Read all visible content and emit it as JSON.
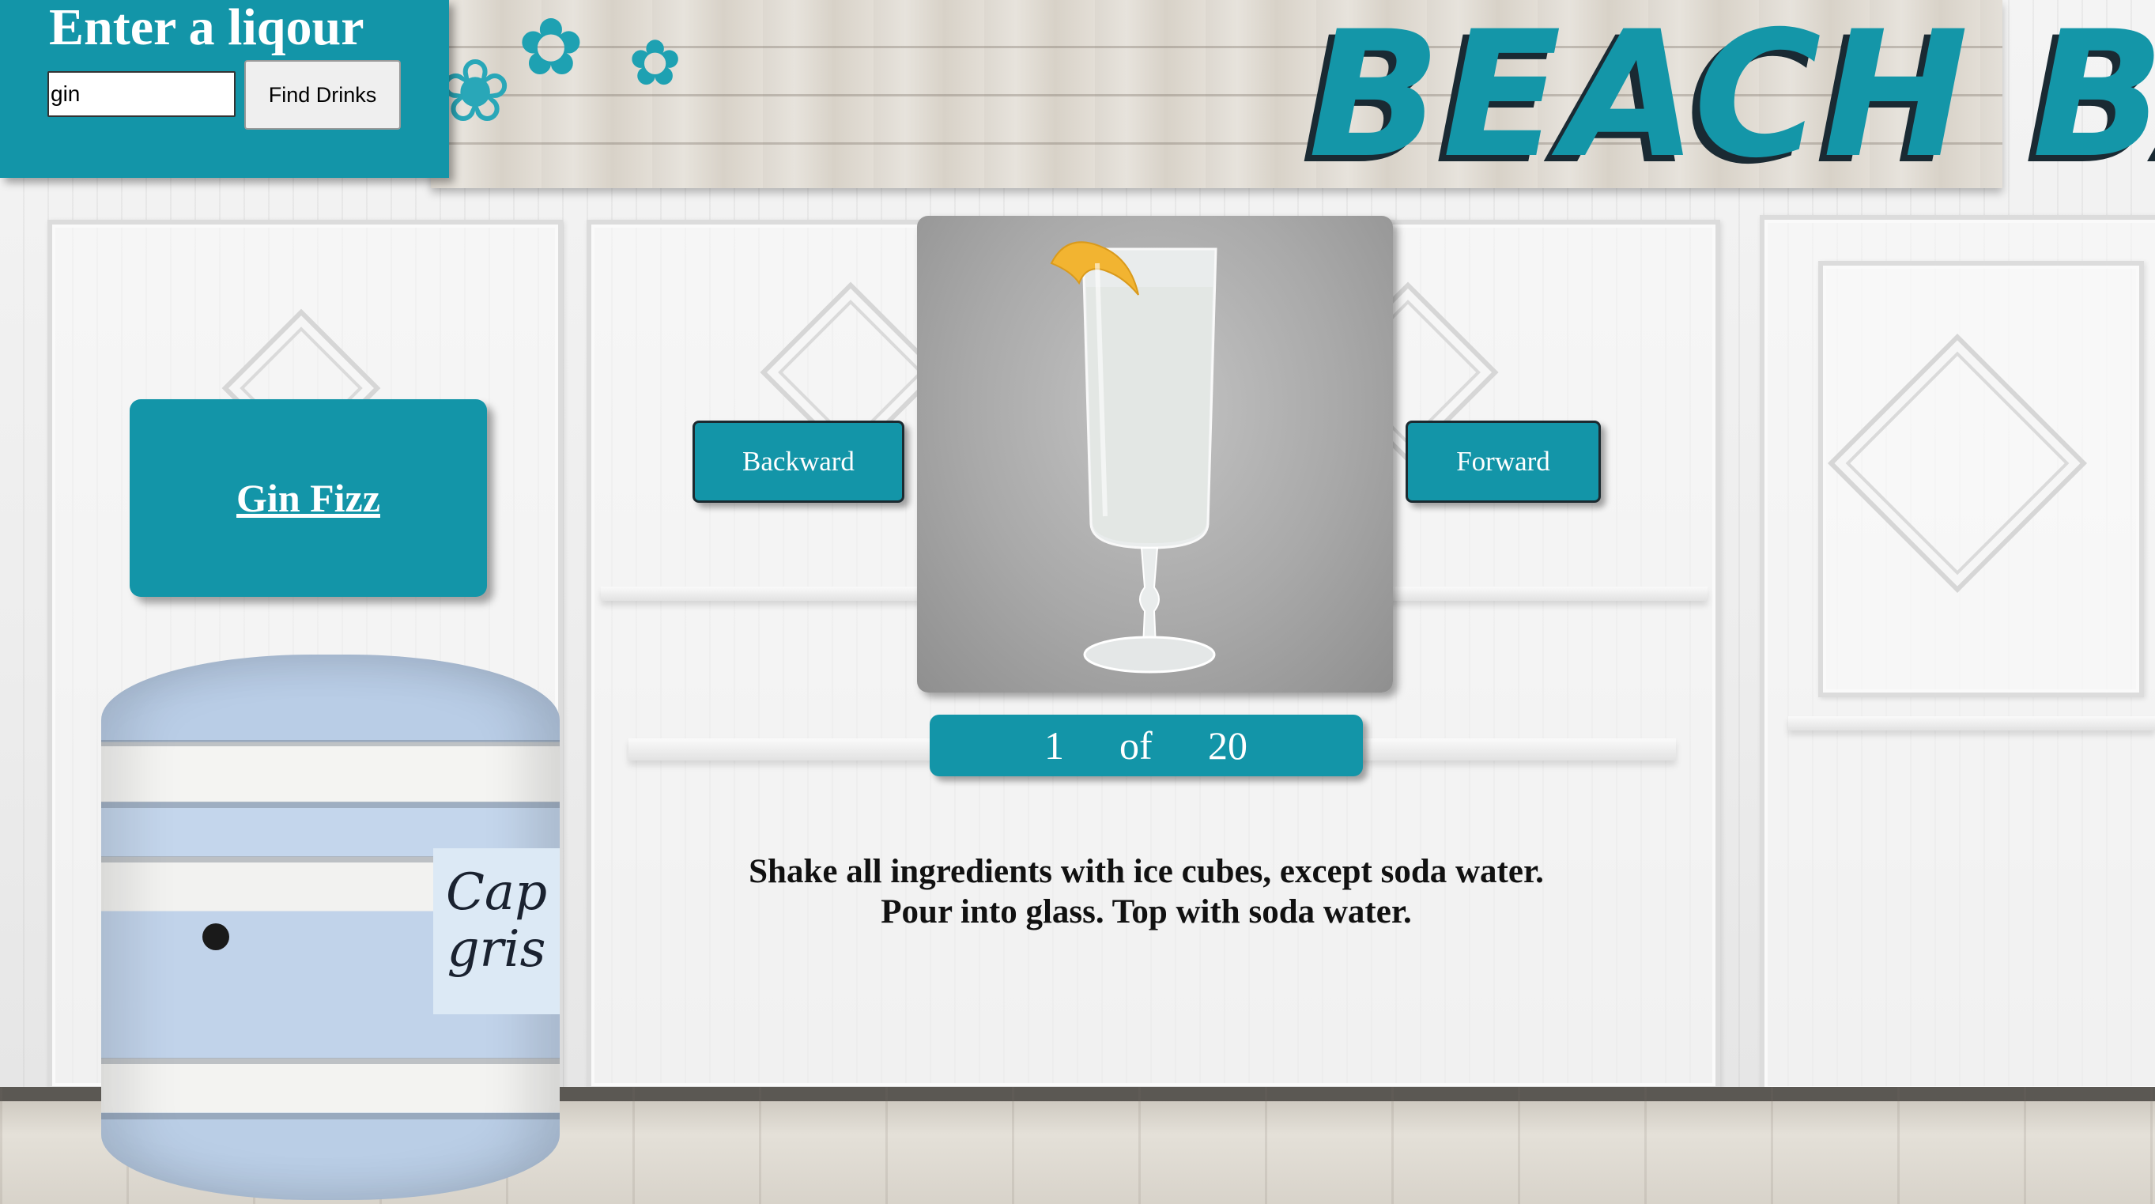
{
  "search": {
    "title": "Enter a liqour",
    "input_value": "gin",
    "button_label": "Find Drinks"
  },
  "sign": {
    "text": "BEACH BAR"
  },
  "barrel": {
    "label_line1": "Cap",
    "label_line2": "gris"
  },
  "drink": {
    "name": "Gin Fizz",
    "image_icon": "cocktail-glass-photo",
    "instructions_line1": "Shake all ingredients with ice cubes, except soda water.",
    "instructions_line2": "Pour into glass. Top with soda water."
  },
  "navigation": {
    "backward_label": "Backward",
    "forward_label": "Forward"
  },
  "pager": {
    "current": "1",
    "separator": "of",
    "total": "20"
  },
  "colors": {
    "accent": "#1395a8",
    "button_border": "#1c2a30",
    "text_dark": "#111111"
  }
}
